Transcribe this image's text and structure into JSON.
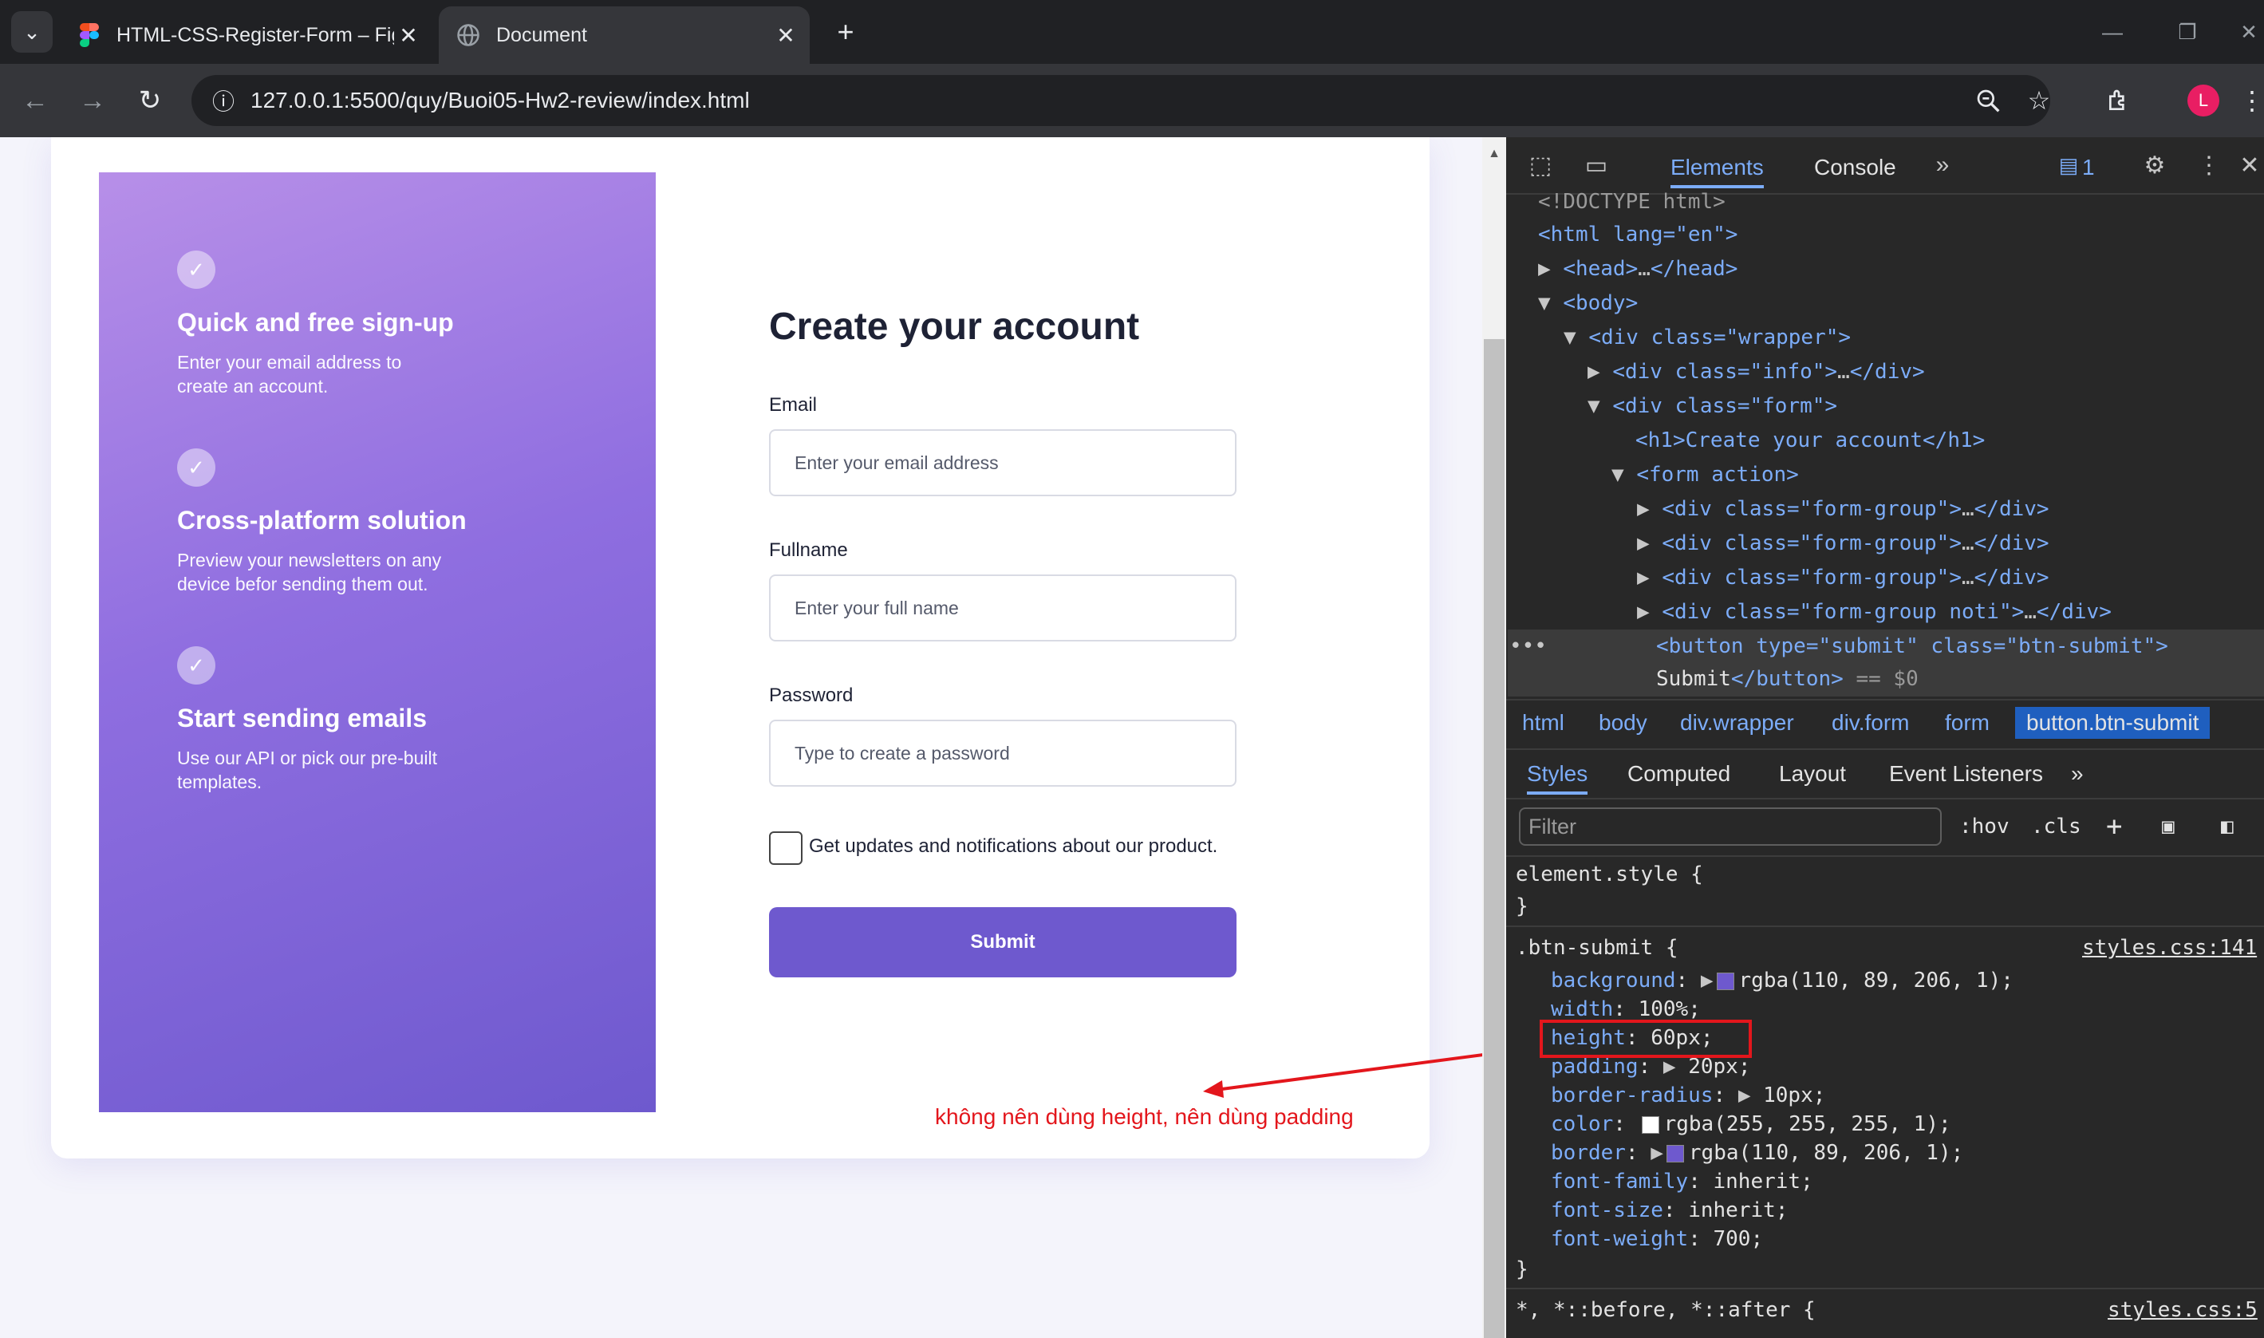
{
  "browser": {
    "tabs": [
      {
        "title": "HTML-CSS-Register-Form – Figma",
        "icon": "figma-icon"
      },
      {
        "title": "Document",
        "icon": "globe-icon"
      }
    ],
    "url": "127.0.0.1:5500/quy/Buoi05-Hw2-review/index.html",
    "profile_initial": "L"
  },
  "page": {
    "features": [
      {
        "title": "Quick and free sign-up",
        "desc": "Enter your email address to create an account."
      },
      {
        "title": "Cross-platform solution",
        "desc": "Preview your newsletters on any device befor sending them out."
      },
      {
        "title": "Start sending emails",
        "desc": "Use our API or pick our pre-built templates."
      }
    ],
    "form_title": "Create your account",
    "fields": [
      {
        "label": "Email",
        "placeholder": "Enter your email address"
      },
      {
        "label": "Fullname",
        "placeholder": "Enter your full name"
      },
      {
        "label": "Password",
        "placeholder": "Type to create a password"
      }
    ],
    "checkbox_label": "Get updates and notifications about our product.",
    "submit_label": "Submit",
    "annotation": "không nên dùng height, nên dùng padding",
    "colors": {
      "accent": "#6e59ce",
      "annotation": "#e3161c"
    }
  },
  "devtools": {
    "tabs": [
      "Elements",
      "Console"
    ],
    "issues_count": "1",
    "dom": {
      "doctype": "<!DOCTYPE html>",
      "html_open": "<html lang=\"en\">",
      "head": "<head>",
      "head_close": "</head>",
      "body": "<body>",
      "wrapper": "<div class=\"wrapper\">",
      "info": "<div class=\"info\">",
      "div_close": "</div>",
      "form_div": "<div class=\"form\">",
      "h1": "<h1>Create your account</h1>",
      "form": "<form action>",
      "fg": "<div class=\"form-group\">",
      "fg_noti": "<div class=\"form-group noti\">",
      "button_open": "<button type=\"submit\" class=\"btn-submit\">",
      "button_text": "Submit",
      "button_close": "</button>",
      "eq": "== $0",
      "ellipsis": "…"
    },
    "breadcrumbs": [
      "html",
      "body",
      "div.wrapper",
      "div.form",
      "form",
      "button.btn-submit"
    ],
    "style_tabs": [
      "Styles",
      "Computed",
      "Layout",
      "Event Listeners"
    ],
    "filter_placeholder": "Filter",
    "hov": ":hov",
    "cls": ".cls",
    "element_style": "element.style {",
    "close_brace": "}",
    "rule_selector": ".btn-submit {",
    "rule_source": "styles.css:141",
    "declarations": [
      {
        "prop": "background",
        "value": "rgba(110, 89, 206, 1);",
        "swatch": "#6e59ce",
        "expand": true
      },
      {
        "prop": "width",
        "value": "100%;"
      },
      {
        "prop": "height",
        "value": "60px;"
      },
      {
        "prop": "padding",
        "value": "20px;",
        "expand": true
      },
      {
        "prop": "border-radius",
        "value": "10px;",
        "expand": true
      },
      {
        "prop": "color",
        "value": "rgba(255, 255, 255, 1);",
        "swatch": "#ffffff"
      },
      {
        "prop": "border",
        "value": "rgba(110, 89, 206, 1);",
        "swatch": "#6e59ce",
        "expand": true
      },
      {
        "prop": "font-family",
        "value": "inherit;"
      },
      {
        "prop": "font-size",
        "value": "inherit;"
      },
      {
        "prop": "font-weight",
        "value": "700;"
      }
    ],
    "universal_selector": "*, *::before, *::after {",
    "universal_source": "styles.css:5"
  }
}
